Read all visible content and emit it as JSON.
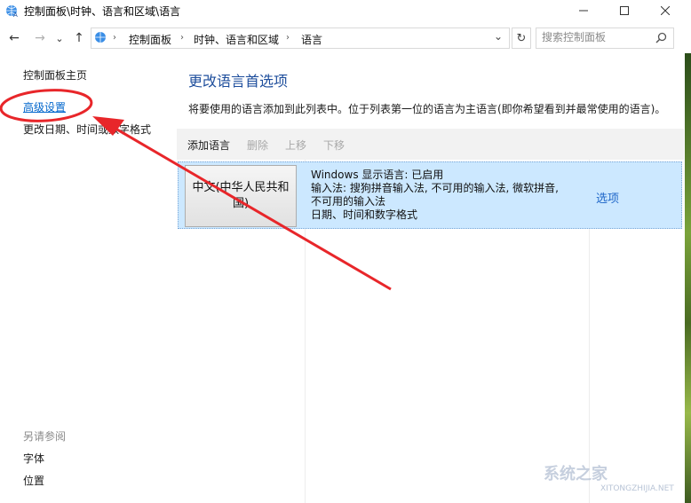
{
  "window": {
    "title": "控制面板\\时钟、语言和区域\\语言",
    "minimize": "—",
    "maximize": "☐",
    "close": "✕"
  },
  "nav": {
    "back": "←",
    "forward": "→",
    "recent": "⌄",
    "up": "↑"
  },
  "address": {
    "crumbs": [
      "控制面板",
      "时钟、语言和区域",
      "语言"
    ],
    "separator": "›",
    "dropdown": "⌄",
    "refresh": "↻"
  },
  "search": {
    "placeholder": "搜索控制面板",
    "icon": "search-icon"
  },
  "sidebar": {
    "home": "控制面板主页",
    "advanced": "高级设置",
    "datetime": "更改日期、时间或数字格式",
    "see_also": "另请参阅",
    "fonts": "字体",
    "location": "位置"
  },
  "main": {
    "title": "更改语言首选项",
    "description": "将要使用的语言添加到此列表中。位于列表第一位的语言为主语言(即你希望看到并最常使用的语言)。",
    "toolbar": {
      "add": "添加语言",
      "remove": "删除",
      "move_up": "上移",
      "move_down": "下移"
    },
    "languages": [
      {
        "name": "中文(中华人民共和国)",
        "line1": "Windows 显示语言: 已启用",
        "line2": "输入法: 搜狗拼音输入法, 不可用的输入法, 微软拼音,",
        "line3": "不可用的输入法",
        "line4": "日期、时间和数字格式",
        "options": "选项"
      }
    ]
  },
  "watermark": {
    "text": "系统之家",
    "url": "XITONGZHIJIA.NET"
  },
  "colors": {
    "accent": "#1e4e9c",
    "link": "#0066cc",
    "selection": "#cce8ff",
    "annotation": "#e8262a"
  }
}
